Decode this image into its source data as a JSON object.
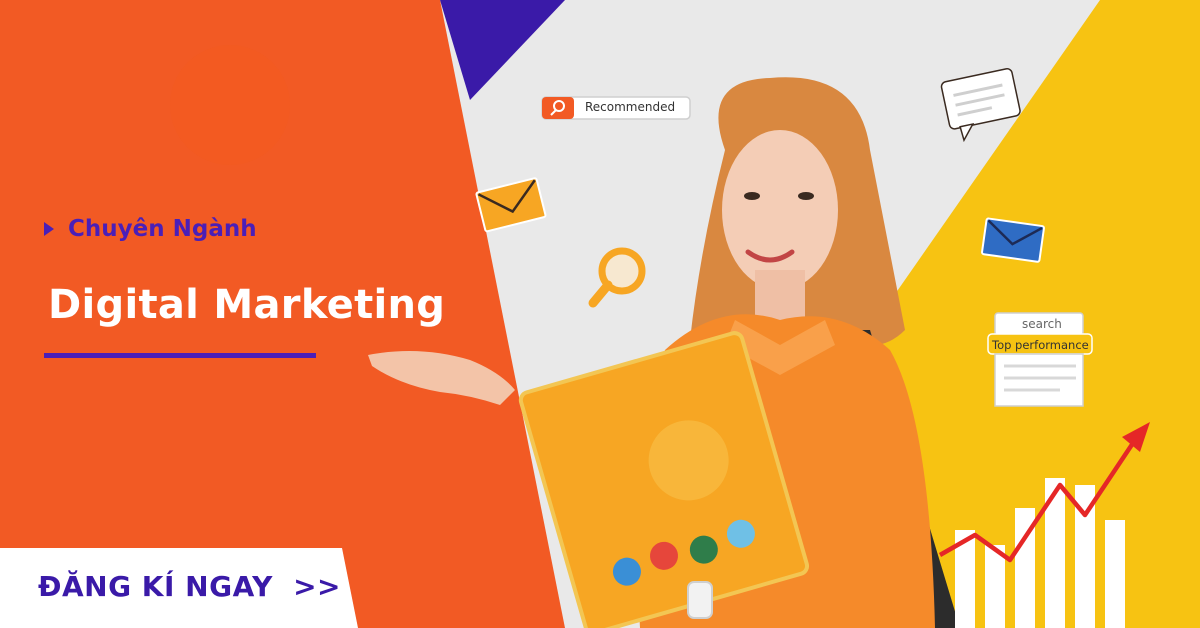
{
  "banner": {
    "subheading": "Chuyên Ngành",
    "title": "Digital Marketing",
    "cta": {
      "label": "ĐĂNG KÍ NGAY",
      "arrows": ">>"
    }
  },
  "stickers": {
    "recommended": "Recommended",
    "search": "search",
    "top_performance": "Top performance"
  },
  "icons": [
    "play-triangle-icon",
    "search-icon",
    "mail-icon",
    "message-icon",
    "magnifier-icon",
    "trend-arrow-icon",
    "bar-chart-icon"
  ],
  "colors": {
    "orange": "#f25a24",
    "purple": "#3a1aa8",
    "yellow": "#f7c312",
    "gray": "#e9e9e9",
    "white": "#ffffff"
  }
}
